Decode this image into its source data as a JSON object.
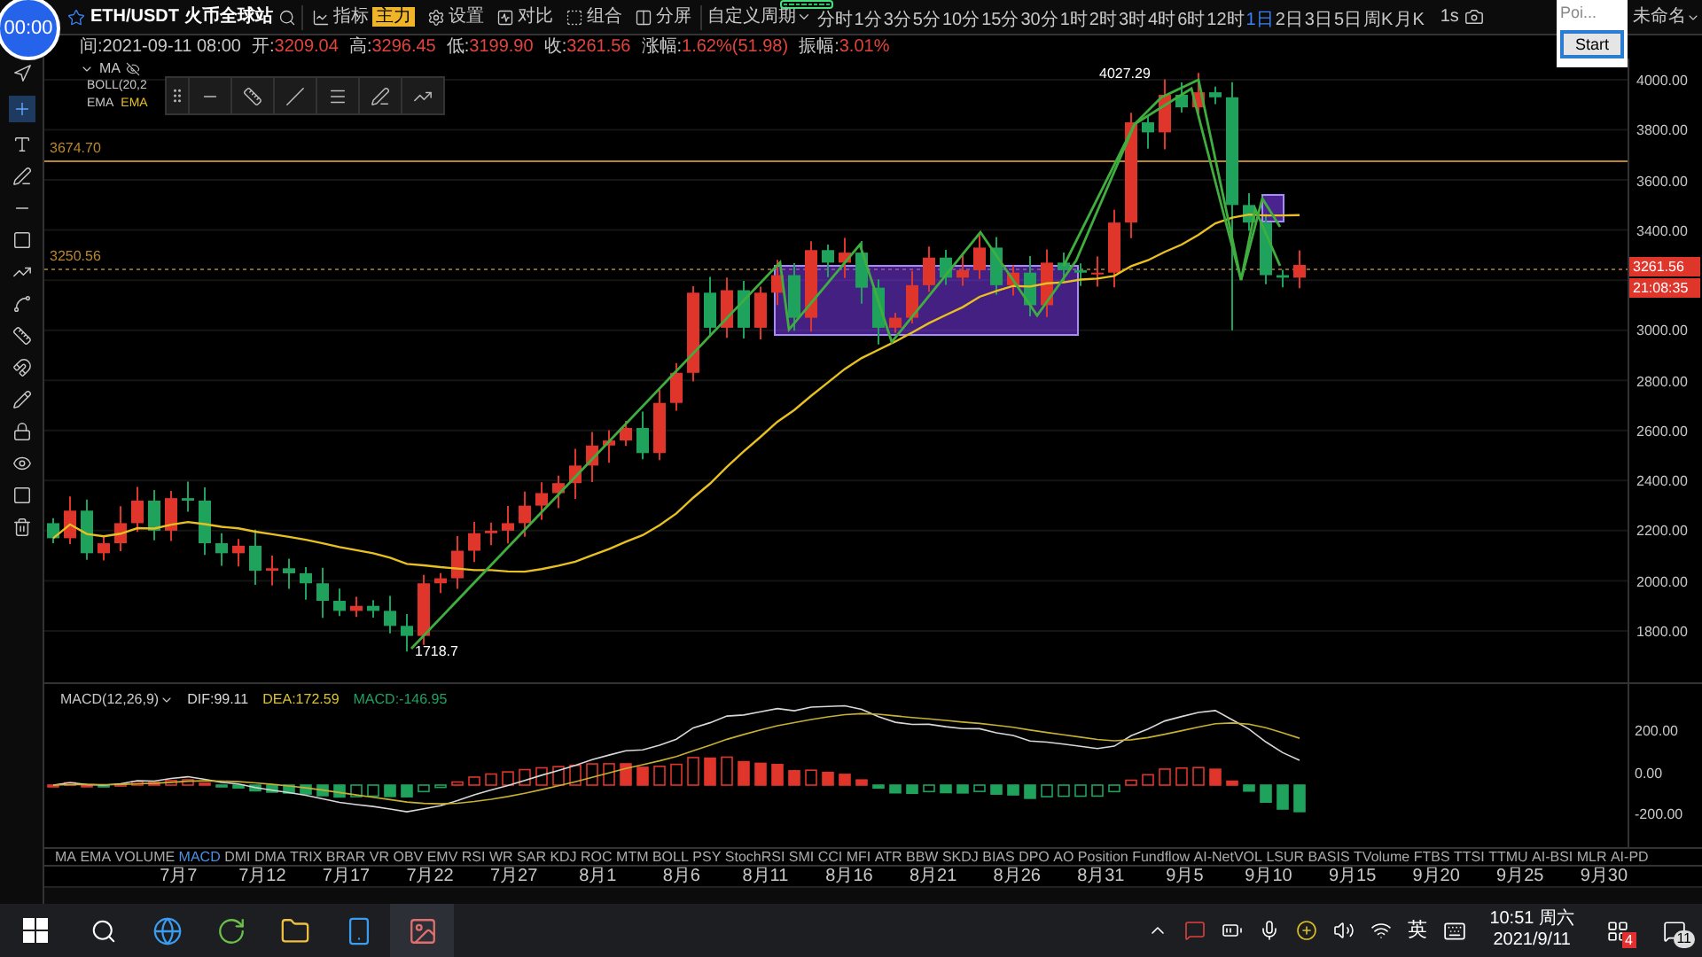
{
  "timer": {
    "text": "00:00"
  },
  "toolbar": {
    "symbol": "ETH/USDT 火币全球站",
    "buttons": [
      {
        "kind": "indicator",
        "label": "指标",
        "badge": "主力"
      },
      {
        "kind": "settings",
        "label": "设置"
      },
      {
        "kind": "compare",
        "label": "对比"
      },
      {
        "kind": "combine",
        "label": "组合"
      },
      {
        "kind": "split",
        "label": "分屏"
      }
    ],
    "custom_period": "自定义周期",
    "periods": [
      {
        "label": "分时",
        "selected": false
      },
      {
        "label": "1分",
        "selected": false
      },
      {
        "label": "3分",
        "selected": false
      },
      {
        "label": "5分",
        "selected": false
      },
      {
        "label": "10分",
        "selected": false
      },
      {
        "label": "15分",
        "selected": false
      },
      {
        "label": "30分",
        "selected": false
      },
      {
        "label": "1时",
        "selected": false
      },
      {
        "label": "2时",
        "selected": false
      },
      {
        "label": "3时",
        "selected": false
      },
      {
        "label": "4时",
        "selected": false
      },
      {
        "label": "6时",
        "selected": false
      },
      {
        "label": "12时",
        "selected": false
      },
      {
        "label": "1日",
        "selected": true
      },
      {
        "label": "2日",
        "selected": false
      },
      {
        "label": "3日",
        "selected": false
      },
      {
        "label": "5日",
        "selected": false
      },
      {
        "label": "周K",
        "selected": false
      },
      {
        "label": "月K",
        "selected": false
      }
    ],
    "interval": "1s",
    "layout_name": "未命名"
  },
  "popup": {
    "text": "Poi...",
    "button": "Start"
  },
  "info_row": [
    {
      "kind": "time",
      "label": "间:",
      "value": "2021-09-11 08:00"
    },
    {
      "kind": "price",
      "label": "开:",
      "value": "3209.04"
    },
    {
      "kind": "price",
      "label": "高:",
      "value": "3296.45"
    },
    {
      "kind": "price",
      "label": "低:",
      "value": "3199.90"
    },
    {
      "kind": "price",
      "label": "收:",
      "value": "3261.56"
    },
    {
      "kind": "price",
      "label": "涨幅:",
      "value": "1.62%(51.98)"
    },
    {
      "kind": "price",
      "label": "振幅:",
      "value": "3.01%"
    }
  ],
  "legend": [
    {
      "label": "MA",
      "color": "#c8c8c8"
    },
    {
      "label": "BOLL(20,2",
      "color": "#c8c8c8"
    },
    {
      "label": "EMA",
      "color": "#c8c8c8"
    },
    {
      "label": "EMA",
      "color": "#e8c020"
    }
  ],
  "chart_labels": {
    "high": "4027.29",
    "low": "1718.7",
    "line_upper": "3674.70",
    "line_lower": "3250.56"
  },
  "price_axis": {
    "ticks_above": [
      "4000.00",
      "3800.00",
      "3600.00",
      "3400.00"
    ],
    "ticks_below": [
      "3000.00",
      "2800.00",
      "2600.00",
      "2400.00",
      "2200.00",
      "2000.00",
      "1800.00"
    ],
    "current_price": "3261.56",
    "countdown": "21:08:35"
  },
  "macd": {
    "title": "MACD(12,26,9)",
    "dif": "DIF:99.11",
    "dea": "DEA:172.59",
    "macd": "MACD:-146.95",
    "ticks": [
      "200.00",
      "0.00",
      "-200.00"
    ]
  },
  "indicator_tabs": [
    {
      "label": "MA",
      "selected": false
    },
    {
      "label": "EMA",
      "selected": false
    },
    {
      "label": "VOLUME",
      "selected": false
    },
    {
      "label": "MACD",
      "selected": true
    },
    {
      "label": "DMI",
      "selected": false
    },
    {
      "label": "DMA",
      "selected": false
    },
    {
      "label": "TRIX",
      "selected": false
    },
    {
      "label": "BRAR",
      "selected": false
    },
    {
      "label": "VR",
      "selected": false
    },
    {
      "label": "OBV",
      "selected": false
    },
    {
      "label": "EMV",
      "selected": false
    },
    {
      "label": "RSI",
      "selected": false
    },
    {
      "label": "WR",
      "selected": false
    },
    {
      "label": "SAR",
      "selected": false
    },
    {
      "label": "KDJ",
      "selected": false
    },
    {
      "label": "ROC",
      "selected": false
    },
    {
      "label": "MTM",
      "selected": false
    },
    {
      "label": "BOLL",
      "selected": false
    },
    {
      "label": "PSY",
      "selected": false
    },
    {
      "label": "StochRSI",
      "selected": false
    },
    {
      "label": "SMI",
      "selected": false
    },
    {
      "label": "CCI",
      "selected": false
    },
    {
      "label": "MFI",
      "selected": false
    },
    {
      "label": "ATR",
      "selected": false
    },
    {
      "label": "BBW",
      "selected": false
    },
    {
      "label": "SKDJ",
      "selected": false
    },
    {
      "label": "BIAS",
      "selected": false
    },
    {
      "label": "DPO",
      "selected": false
    },
    {
      "label": "AO",
      "selected": false
    },
    {
      "label": "Position",
      "selected": false
    },
    {
      "label": "Fundflow",
      "selected": false
    },
    {
      "label": "AI-NetVOL",
      "selected": false
    },
    {
      "label": "LSUR",
      "selected": false
    },
    {
      "label": "BASIS",
      "selected": false
    },
    {
      "label": "TVolume",
      "selected": false
    },
    {
      "label": "FTBS",
      "selected": false
    },
    {
      "label": "TTSI",
      "selected": false
    },
    {
      "label": "TTMU",
      "selected": false
    },
    {
      "label": "AI-BSI",
      "selected": false
    },
    {
      "label": "MLR",
      "selected": false
    },
    {
      "label": "AI-PD",
      "selected": false
    }
  ],
  "dates": [
    "7月7",
    "7月12",
    "7月17",
    "7月22",
    "7月27",
    "8月1",
    "8月6",
    "8月11",
    "8月16",
    "8月21",
    "8月26",
    "8月31",
    "9月5",
    "9月10",
    "9月15",
    "9月20",
    "9月25",
    "9月30"
  ],
  "taskbar": {
    "ime": "英",
    "time": "10:51 周六",
    "date": "2021/9/11",
    "notification_badge": "4",
    "action_badge": "11"
  }
}
